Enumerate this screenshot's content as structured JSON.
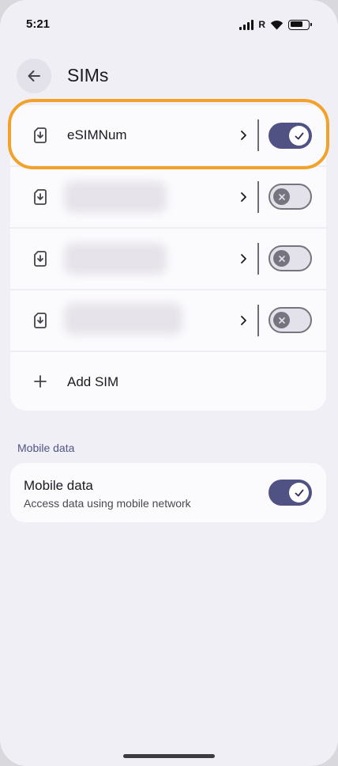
{
  "status_bar": {
    "time": "5:21",
    "roaming": "R"
  },
  "header": {
    "title": "SIMs"
  },
  "sim_list": {
    "items": [
      {
        "name": "eSIMNum",
        "enabled": true,
        "blurred": false
      },
      {
        "name": "",
        "enabled": false,
        "blurred": true
      },
      {
        "name": "",
        "enabled": false,
        "blurred": true
      },
      {
        "name": "",
        "enabled": false,
        "blurred": true
      }
    ],
    "add_label": "Add SIM"
  },
  "mobile_data": {
    "section_heading": "Mobile data",
    "title": "Mobile data",
    "subtitle": "Access data using mobile network",
    "enabled": true
  },
  "colors": {
    "accent": "#515284",
    "highlight": "#f2a22a",
    "background": "#f1eff6",
    "card": "#fbfafd"
  }
}
